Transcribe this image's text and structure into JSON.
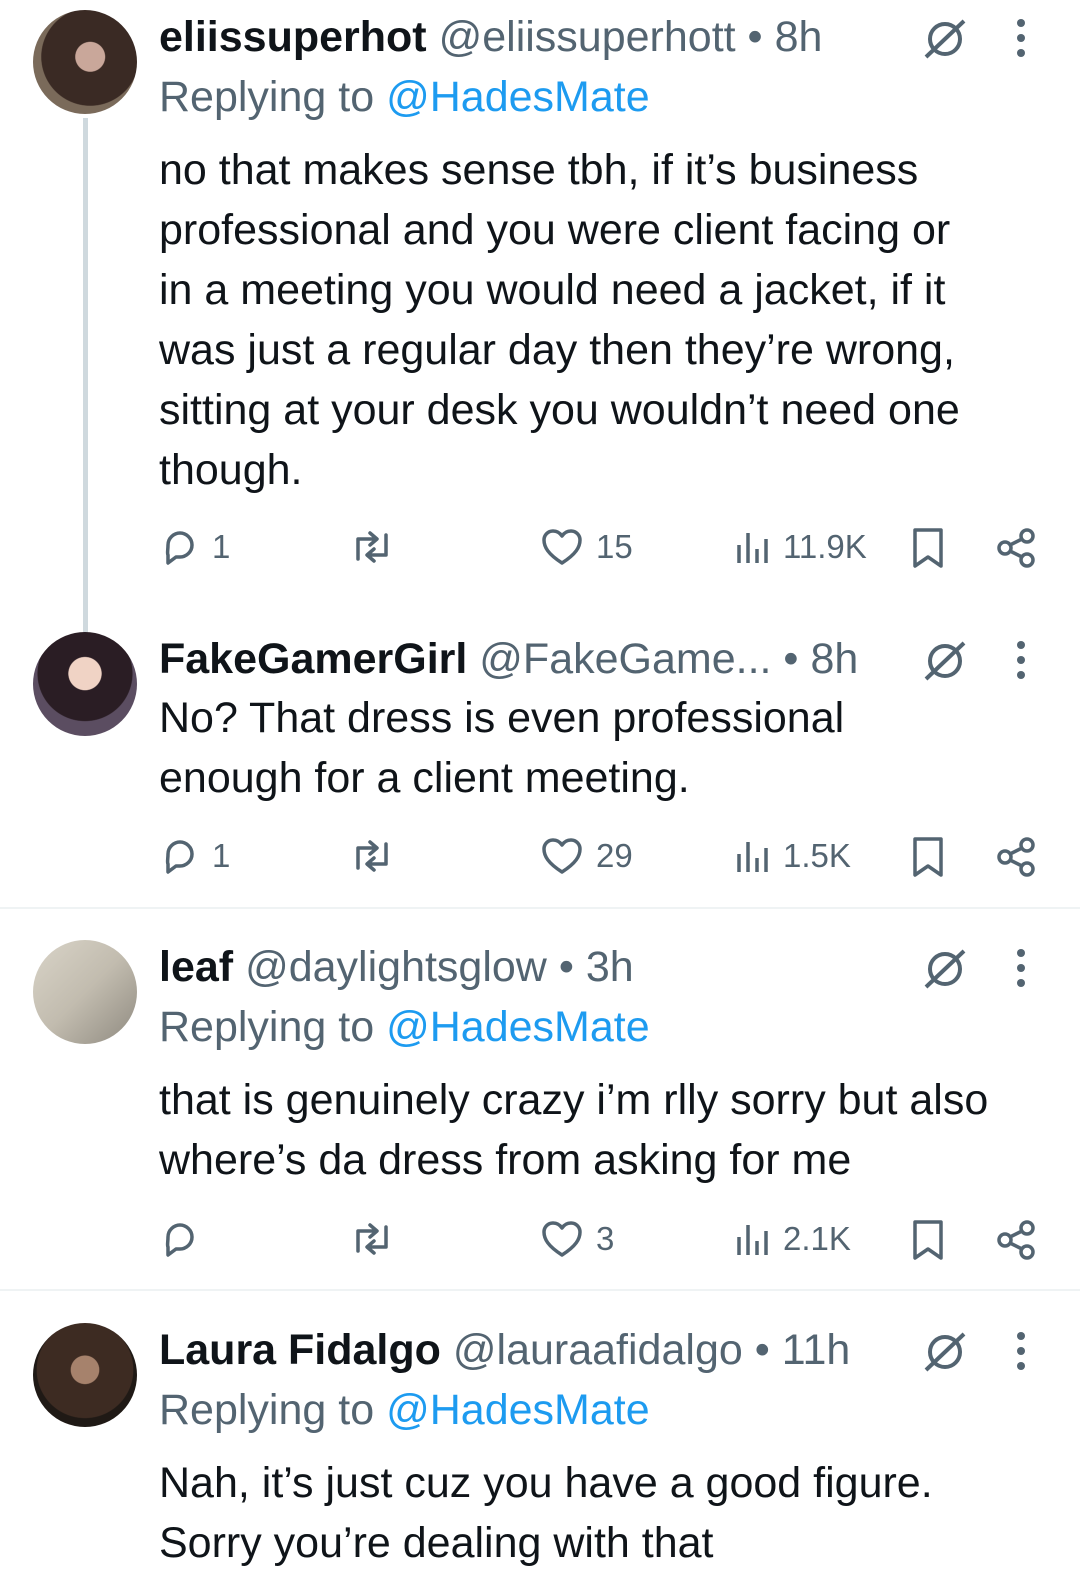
{
  "tweets": [
    {
      "name": "eliissuperhot",
      "handle": "@eliissuperhott",
      "separator": "•",
      "time": "8h",
      "replying_prefix": "Replying to",
      "replying_to": "@HadesMate",
      "text_lines": [
        "no that makes sense tbh, if it’s business",
        "professional and you were client facing or",
        "in a meeting you would need a jacket, if it",
        "was just a regular day then they’re wrong,",
        "sitting at your desk you wouldn’t need one",
        "though."
      ],
      "replies": "1",
      "retweets": "",
      "likes": "15",
      "views": "11.9K"
    },
    {
      "name": "FakeGamerGirl",
      "handle": "@FakeGame...",
      "separator": "•",
      "time": "8h",
      "text_lines": [
        "No? That dress is even professional",
        "enough for a client meeting."
      ],
      "replies": "1",
      "retweets": "",
      "likes": "29",
      "views": "1.5K"
    },
    {
      "name": "leaf",
      "handle": "@daylightsglow",
      "separator": "•",
      "time": "3h",
      "replying_prefix": "Replying to",
      "replying_to": "@HadesMate",
      "text_lines": [
        "that is genuinely crazy i’m rlly sorry but also",
        "where’s da dress from asking for me"
      ],
      "replies": "",
      "retweets": "",
      "likes": "3",
      "views": "2.1K"
    },
    {
      "name": "Laura Fidalgo",
      "handle": "@lauraafidalgo",
      "separator": "•",
      "time": "11h",
      "replying_prefix": "Replying to",
      "replying_to": "@HadesMate",
      "text_lines": [
        "Nah, it’s just cuz you have a good figure.",
        "Sorry you’re dealing with that"
      ]
    }
  ],
  "icons": {
    "reply": "reply-icon",
    "retweet": "retweet-icon",
    "like": "heart-icon",
    "views": "views-icon",
    "bookmark": "bookmark-icon",
    "share": "share-icon",
    "grok": "grok-icon",
    "more": "more-icon"
  },
  "colors": {
    "text": "#0f1419",
    "muted": "#536471",
    "link": "#1d9bf0",
    "divider": "#eff3f4",
    "thread_line": "#cfd9de"
  }
}
